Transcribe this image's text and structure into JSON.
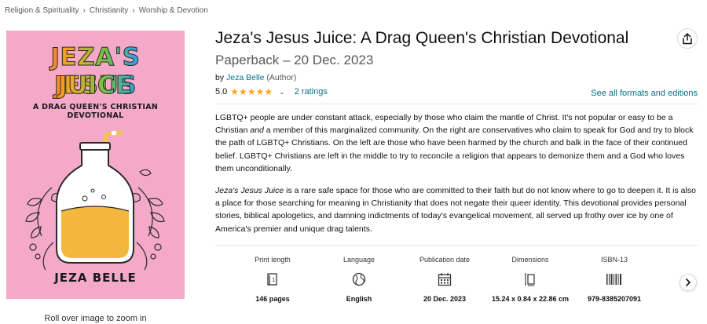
{
  "breadcrumb": [
    "Religion & Spirituality",
    "Christianity",
    "Worship & Devotion"
  ],
  "breadcrumb_separator": "›",
  "cover": {
    "line1": "JEZA'S JESUS",
    "line2": "JUICE",
    "subtitle": "A DRAG QUEEN'S CHRISTIAN DEVOTIONAL",
    "author": "JEZA BELLE",
    "background": "#f4a9c9"
  },
  "zoom_hint": "Roll over image to zoom in",
  "product": {
    "title": "Jeza's Jesus Juice: A Drag Queen's Christian Devotional",
    "format_date": "Paperback – 20 Dec. 2023",
    "by": "by",
    "author": "Jeza Belle",
    "author_role": "(Author)",
    "rating": "5.0",
    "stars": "★★★★★",
    "ratings_count": "2 ratings",
    "formats_link": "See all formats and editions"
  },
  "description": {
    "p1_start": "LGBTQ+ people are under constant attack, especially by those who claim the mantle of Christ. It's not popular or easy to be a Christian ",
    "p1_em": "and",
    "p1_end": " a member of this marginalized community. On the right are conservatives who claim to speak for God and try to block the path of LGBTQ+ Christians. On the left are those who have been harmed by the church and balk in the face of their continued belief. LGBTQ+ Christians are left in the middle to try to reconcile a religion that appears to demonize them and a God who loves them unconditionally.",
    "p2_em": "Jeza's Jesus Juice",
    "p2_end": " is a rare safe space for those who are committed to their faith but do not know where to go to deepen it. It is also a place for those searching for meaning in Christianity that does not negate their queer identity. This devotional provides personal stories, biblical apologetics, and damning indictments of today's evangelical movement, all served up frothy over ice by one of America's premier and unique drag talents."
  },
  "details": [
    {
      "label": "Print length",
      "icon": "book-pages-icon",
      "value": "146 pages"
    },
    {
      "label": "Language",
      "icon": "globe-icon",
      "value": "English"
    },
    {
      "label": "Publication date",
      "icon": "calendar-icon",
      "value": "20 Dec. 2023"
    },
    {
      "label": "Dimensions",
      "icon": "ruler-book-icon",
      "value": "15.24 x 0.84 x 22.86 cm"
    },
    {
      "label": "ISBN-13",
      "icon": "barcode-icon",
      "value": "979-8385207091"
    }
  ],
  "colors": {
    "link": "#007185",
    "star": "#ffa41c",
    "text": "#0f1111",
    "muted": "#565959"
  }
}
